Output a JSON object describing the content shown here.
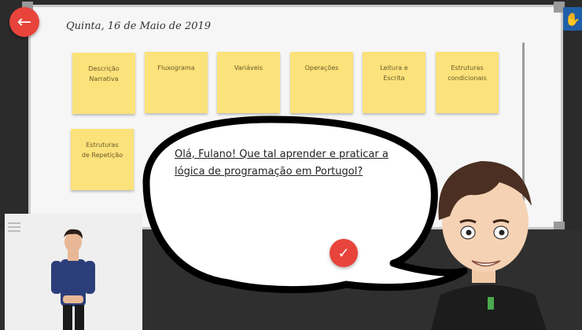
{
  "header": {
    "date": "Quinta, 16 de Maio de 2019"
  },
  "board": {
    "notes": [
      {
        "label": "Descrição\nNarrativa"
      },
      {
        "label": "Fluxograma"
      },
      {
        "label": "Variáveis"
      },
      {
        "label": "Operações"
      },
      {
        "label": "Leitura e\nEscrita"
      },
      {
        "label": "Estruturas\ncondicionais"
      },
      {
        "label": "Estruturas\nde Repetição"
      }
    ]
  },
  "dialog": {
    "message": "Olá, Fulano! Que tal aprender e praticar a lógica de programação em Portugol?"
  },
  "icons": {
    "back": "arrow-left-icon",
    "libras": "sign-language-icon",
    "menu": "hamburger-menu-icon",
    "confirm": "check-icon"
  },
  "colors": {
    "accent": "#e8443b",
    "note": "#fbe27a",
    "libras": "#1f5fa8"
  }
}
